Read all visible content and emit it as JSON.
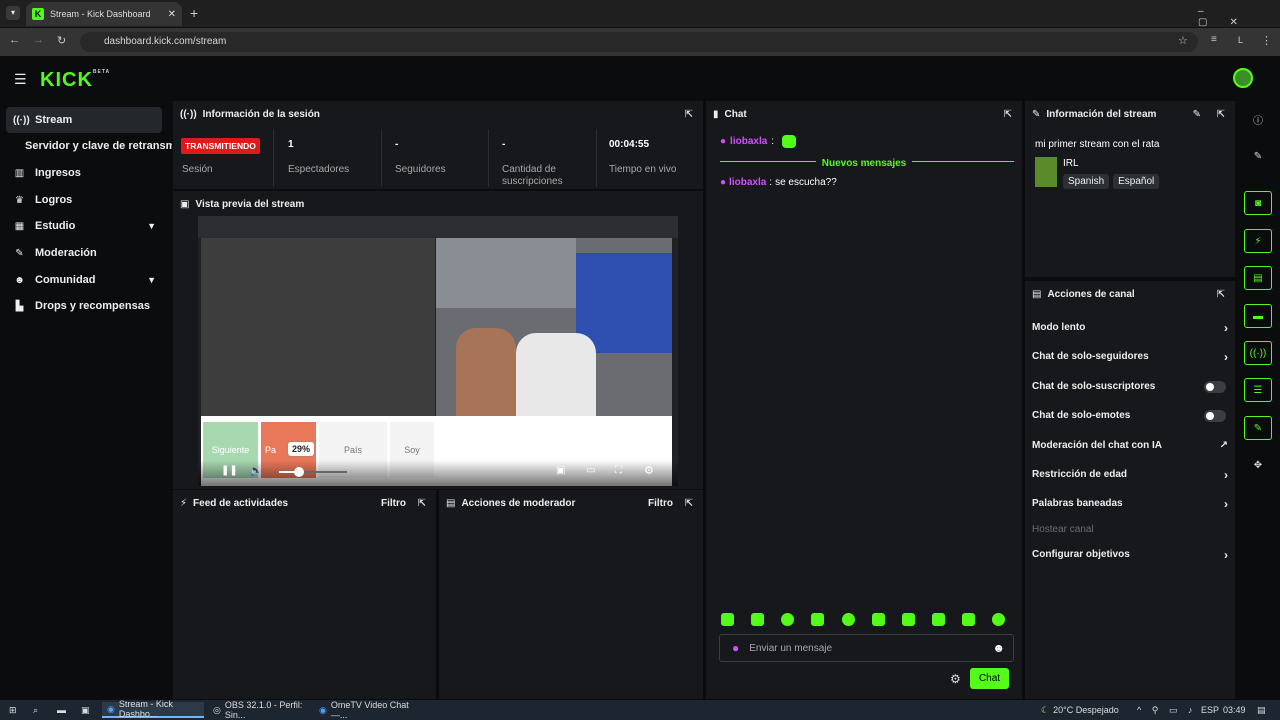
{
  "browser": {
    "tab_title": "Stream - Kick Dashboard",
    "url": "dashboard.kick.com/stream",
    "profile": "L"
  },
  "brand": {
    "logo": "KICK",
    "beta": "BETA",
    "accent": "#53fc18",
    "live_red": "#e01a1a"
  },
  "sidebar": {
    "items": [
      {
        "label": "Stream",
        "icon": "broadcast-icon",
        "active": true
      },
      {
        "label": "Servidor y clave de retransm",
        "icon": "",
        "active": false
      },
      {
        "label": "Ingresos",
        "icon": "chart-icon"
      },
      {
        "label": "Logros",
        "icon": "trophy-icon"
      },
      {
        "label": "Estudio",
        "icon": "studio-icon",
        "expandable": true
      },
      {
        "label": "Moderación",
        "icon": "wrench-icon"
      },
      {
        "label": "Comunidad",
        "icon": "community-icon",
        "expandable": true
      },
      {
        "label": "Drops y recompensas",
        "icon": "drops-icon"
      }
    ]
  },
  "session": {
    "title": "Información de la sesión",
    "badge": "TRANSMITIENDO",
    "badge_label": "Sesión",
    "stats": [
      {
        "value": "1",
        "label": "Espectadores"
      },
      {
        "value": "-",
        "label": "Seguidores"
      },
      {
        "value": "-",
        "label": "Cantidad de suscripciones"
      },
      {
        "value": "00:04:55",
        "label": "Tiempo en vivo"
      }
    ]
  },
  "preview": {
    "title": "Vista previa del stream",
    "volume_tooltip": "29%",
    "volume_percent": 29,
    "overlay_buttons": [
      "Siguiente",
      "Pa",
      "País",
      "Soy"
    ]
  },
  "feed": {
    "title": "Feed de actividades",
    "filter": "Filtro"
  },
  "modactions": {
    "title": "Acciones de moderador",
    "filter": "Filtro"
  },
  "chat": {
    "title": "Chat",
    "new_messages": "Nuevos mensajes",
    "messages": [
      {
        "user": "liobaxla",
        "text": ""
      },
      {
        "user": "liobaxla",
        "text": "se escucha??"
      }
    ],
    "input_placeholder": "Enviar un mensaje",
    "send_label": "Chat"
  },
  "stream_info": {
    "title": "Información del stream",
    "stream_title": "mi primer stream con el rata",
    "category": "IRL",
    "tags": [
      "Spanish",
      "Español"
    ]
  },
  "channel_actions": {
    "title": "Acciones de canal",
    "items": [
      {
        "label": "Modo lento",
        "control": "chevron"
      },
      {
        "label": "Chat de solo-seguidores",
        "control": "chevron"
      },
      {
        "label": "Chat de solo-suscriptores",
        "control": "toggle",
        "on": false
      },
      {
        "label": "Chat de solo-emotes",
        "control": "toggle",
        "on": false
      },
      {
        "label": "Moderación del chat con IA",
        "control": "external"
      },
      {
        "label": "Restricción de edad",
        "control": "chevron"
      },
      {
        "label": "Palabras baneadas",
        "control": "chevron"
      },
      {
        "label": "Hostear canal",
        "control": "none",
        "disabled": true
      },
      {
        "label": "Configurar objetivos",
        "control": "chevron"
      }
    ]
  },
  "taskbar": {
    "apps": [
      "Stream - Kick Dashbo...",
      "OBS 32.1.0 - Perfil: Sin...",
      "OmeTV Video Chat —..."
    ],
    "weather": "20°C Despejado",
    "lang": "ESP",
    "time": "03:49"
  }
}
